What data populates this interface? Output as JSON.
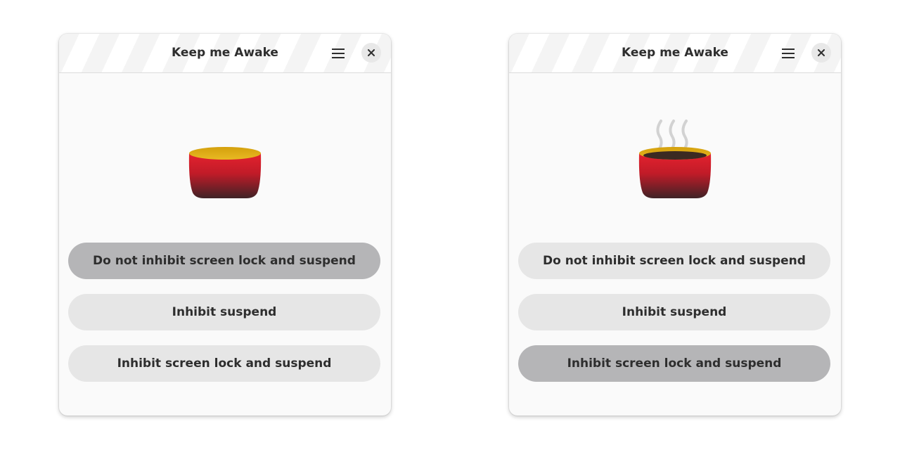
{
  "windows": [
    {
      "title": "Keep me Awake",
      "icons": {
        "menu": "hamburger-menu-icon",
        "close": "close-icon",
        "cup": "coffee-cup-icon"
      },
      "cup_state": "empty",
      "buttons": [
        {
          "label": "Do not inhibit screen lock and suspend",
          "active": true
        },
        {
          "label": "Inhibit suspend",
          "active": false
        },
        {
          "label": "Inhibit screen lock and suspend",
          "active": false
        }
      ]
    },
    {
      "title": "Keep me Awake",
      "icons": {
        "menu": "hamburger-menu-icon",
        "close": "close-icon",
        "cup": "steaming-coffee-cup-icon"
      },
      "cup_state": "hot coffee",
      "buttons": [
        {
          "label": "Do not inhibit screen lock and suspend",
          "active": false
        },
        {
          "label": "Inhibit suspend",
          "active": false
        },
        {
          "label": "Inhibit screen lock and suspend",
          "active": true
        }
      ]
    }
  ],
  "colors": {
    "window_bg": "#fafafa",
    "button_bg": "#e6e6e6",
    "button_active_bg": "#b5b5b7",
    "cup_red": "#e0202c",
    "cup_rim_gold": "#d9a50f",
    "coffee": "#3b2a22",
    "steam": "#d2d2d2"
  }
}
